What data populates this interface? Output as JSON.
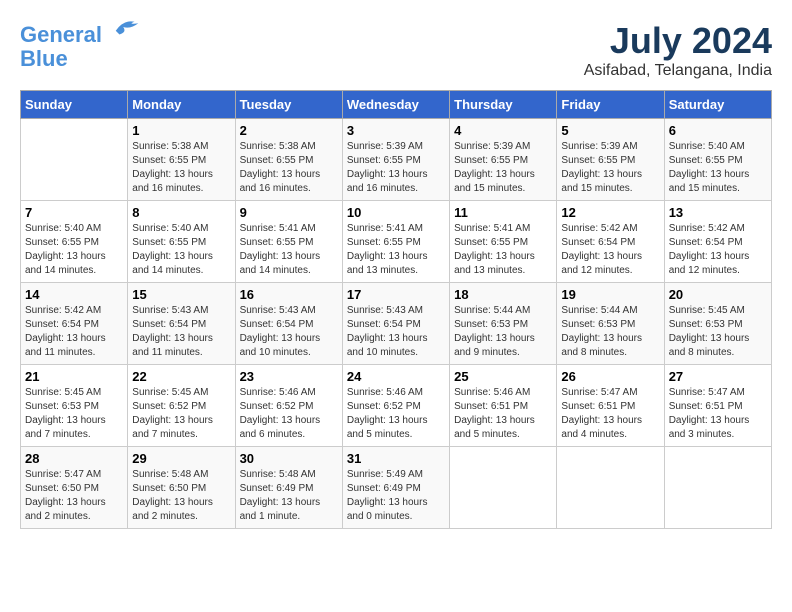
{
  "header": {
    "logo_line1": "General",
    "logo_line2": "Blue",
    "month": "July 2024",
    "location": "Asifabad, Telangana, India"
  },
  "weekdays": [
    "Sunday",
    "Monday",
    "Tuesday",
    "Wednesday",
    "Thursday",
    "Friday",
    "Saturday"
  ],
  "weeks": [
    [
      {
        "day": "",
        "sunrise": "",
        "sunset": "",
        "daylight": ""
      },
      {
        "day": "1",
        "sunrise": "Sunrise: 5:38 AM",
        "sunset": "Sunset: 6:55 PM",
        "daylight": "Daylight: 13 hours and 16 minutes."
      },
      {
        "day": "2",
        "sunrise": "Sunrise: 5:38 AM",
        "sunset": "Sunset: 6:55 PM",
        "daylight": "Daylight: 13 hours and 16 minutes."
      },
      {
        "day": "3",
        "sunrise": "Sunrise: 5:39 AM",
        "sunset": "Sunset: 6:55 PM",
        "daylight": "Daylight: 13 hours and 16 minutes."
      },
      {
        "day": "4",
        "sunrise": "Sunrise: 5:39 AM",
        "sunset": "Sunset: 6:55 PM",
        "daylight": "Daylight: 13 hours and 15 minutes."
      },
      {
        "day": "5",
        "sunrise": "Sunrise: 5:39 AM",
        "sunset": "Sunset: 6:55 PM",
        "daylight": "Daylight: 13 hours and 15 minutes."
      },
      {
        "day": "6",
        "sunrise": "Sunrise: 5:40 AM",
        "sunset": "Sunset: 6:55 PM",
        "daylight": "Daylight: 13 hours and 15 minutes."
      }
    ],
    [
      {
        "day": "7",
        "sunrise": "Sunrise: 5:40 AM",
        "sunset": "Sunset: 6:55 PM",
        "daylight": "Daylight: 13 hours and 14 minutes."
      },
      {
        "day": "8",
        "sunrise": "Sunrise: 5:40 AM",
        "sunset": "Sunset: 6:55 PM",
        "daylight": "Daylight: 13 hours and 14 minutes."
      },
      {
        "day": "9",
        "sunrise": "Sunrise: 5:41 AM",
        "sunset": "Sunset: 6:55 PM",
        "daylight": "Daylight: 13 hours and 14 minutes."
      },
      {
        "day": "10",
        "sunrise": "Sunrise: 5:41 AM",
        "sunset": "Sunset: 6:55 PM",
        "daylight": "Daylight: 13 hours and 13 minutes."
      },
      {
        "day": "11",
        "sunrise": "Sunrise: 5:41 AM",
        "sunset": "Sunset: 6:55 PM",
        "daylight": "Daylight: 13 hours and 13 minutes."
      },
      {
        "day": "12",
        "sunrise": "Sunrise: 5:42 AM",
        "sunset": "Sunset: 6:54 PM",
        "daylight": "Daylight: 13 hours and 12 minutes."
      },
      {
        "day": "13",
        "sunrise": "Sunrise: 5:42 AM",
        "sunset": "Sunset: 6:54 PM",
        "daylight": "Daylight: 13 hours and 12 minutes."
      }
    ],
    [
      {
        "day": "14",
        "sunrise": "Sunrise: 5:42 AM",
        "sunset": "Sunset: 6:54 PM",
        "daylight": "Daylight: 13 hours and 11 minutes."
      },
      {
        "day": "15",
        "sunrise": "Sunrise: 5:43 AM",
        "sunset": "Sunset: 6:54 PM",
        "daylight": "Daylight: 13 hours and 11 minutes."
      },
      {
        "day": "16",
        "sunrise": "Sunrise: 5:43 AM",
        "sunset": "Sunset: 6:54 PM",
        "daylight": "Daylight: 13 hours and 10 minutes."
      },
      {
        "day": "17",
        "sunrise": "Sunrise: 5:43 AM",
        "sunset": "Sunset: 6:54 PM",
        "daylight": "Daylight: 13 hours and 10 minutes."
      },
      {
        "day": "18",
        "sunrise": "Sunrise: 5:44 AM",
        "sunset": "Sunset: 6:53 PM",
        "daylight": "Daylight: 13 hours and 9 minutes."
      },
      {
        "day": "19",
        "sunrise": "Sunrise: 5:44 AM",
        "sunset": "Sunset: 6:53 PM",
        "daylight": "Daylight: 13 hours and 8 minutes."
      },
      {
        "day": "20",
        "sunrise": "Sunrise: 5:45 AM",
        "sunset": "Sunset: 6:53 PM",
        "daylight": "Daylight: 13 hours and 8 minutes."
      }
    ],
    [
      {
        "day": "21",
        "sunrise": "Sunrise: 5:45 AM",
        "sunset": "Sunset: 6:53 PM",
        "daylight": "Daylight: 13 hours and 7 minutes."
      },
      {
        "day": "22",
        "sunrise": "Sunrise: 5:45 AM",
        "sunset": "Sunset: 6:52 PM",
        "daylight": "Daylight: 13 hours and 7 minutes."
      },
      {
        "day": "23",
        "sunrise": "Sunrise: 5:46 AM",
        "sunset": "Sunset: 6:52 PM",
        "daylight": "Daylight: 13 hours and 6 minutes."
      },
      {
        "day": "24",
        "sunrise": "Sunrise: 5:46 AM",
        "sunset": "Sunset: 6:52 PM",
        "daylight": "Daylight: 13 hours and 5 minutes."
      },
      {
        "day": "25",
        "sunrise": "Sunrise: 5:46 AM",
        "sunset": "Sunset: 6:51 PM",
        "daylight": "Daylight: 13 hours and 5 minutes."
      },
      {
        "day": "26",
        "sunrise": "Sunrise: 5:47 AM",
        "sunset": "Sunset: 6:51 PM",
        "daylight": "Daylight: 13 hours and 4 minutes."
      },
      {
        "day": "27",
        "sunrise": "Sunrise: 5:47 AM",
        "sunset": "Sunset: 6:51 PM",
        "daylight": "Daylight: 13 hours and 3 minutes."
      }
    ],
    [
      {
        "day": "28",
        "sunrise": "Sunrise: 5:47 AM",
        "sunset": "Sunset: 6:50 PM",
        "daylight": "Daylight: 13 hours and 2 minutes."
      },
      {
        "day": "29",
        "sunrise": "Sunrise: 5:48 AM",
        "sunset": "Sunset: 6:50 PM",
        "daylight": "Daylight: 13 hours and 2 minutes."
      },
      {
        "day": "30",
        "sunrise": "Sunrise: 5:48 AM",
        "sunset": "Sunset: 6:49 PM",
        "daylight": "Daylight: 13 hours and 1 minute."
      },
      {
        "day": "31",
        "sunrise": "Sunrise: 5:49 AM",
        "sunset": "Sunset: 6:49 PM",
        "daylight": "Daylight: 13 hours and 0 minutes."
      },
      {
        "day": "",
        "sunrise": "",
        "sunset": "",
        "daylight": ""
      },
      {
        "day": "",
        "sunrise": "",
        "sunset": "",
        "daylight": ""
      },
      {
        "day": "",
        "sunrise": "",
        "sunset": "",
        "daylight": ""
      }
    ]
  ]
}
